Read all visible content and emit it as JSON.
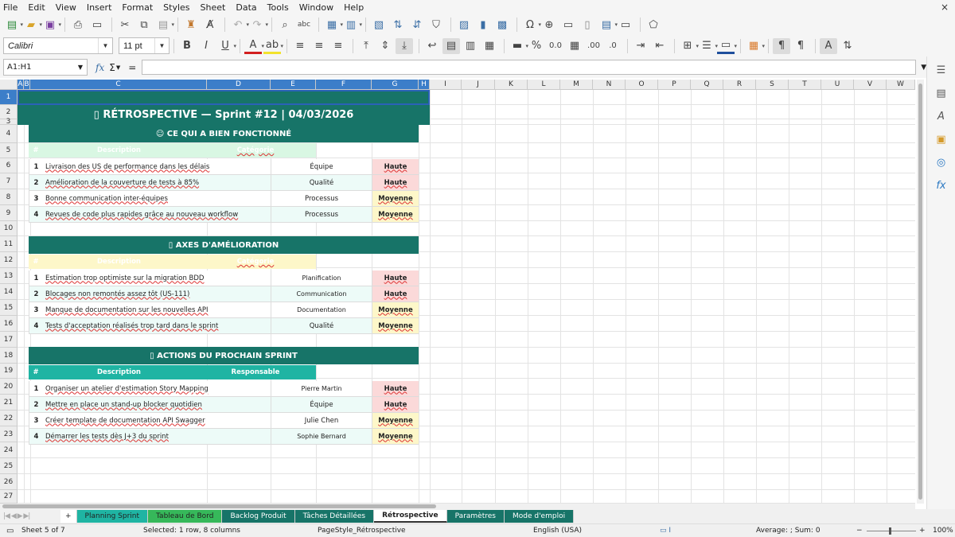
{
  "menu": [
    "File",
    "Edit",
    "View",
    "Insert",
    "Format",
    "Styles",
    "Sheet",
    "Data",
    "Tools",
    "Window",
    "Help"
  ],
  "close_glyph": "×",
  "font": {
    "name": "Calibri",
    "size": "11 pt"
  },
  "namebox": "A1:H1",
  "formula": {
    "fx": "fx",
    "sigma": "Σ",
    "eq": "="
  },
  "columns": [
    "A",
    "B",
    "C",
    "D",
    "E",
    "F",
    "G",
    "H",
    "I",
    "J",
    "K",
    "L",
    "M",
    "N",
    "O",
    "P",
    "Q",
    "R",
    "S",
    "T",
    "U",
    "V",
    "W"
  ],
  "rows": [
    "1",
    "2",
    "3",
    "4",
    "5",
    "6",
    "7",
    "8",
    "9",
    "10",
    "11",
    "12",
    "13",
    "14",
    "15",
    "16",
    "17",
    "18",
    "19",
    "20",
    "21",
    "22",
    "23",
    "24",
    "25",
    "26",
    "27"
  ],
  "title": "▯ RÉTROSPECTIVE  —  Sprint #12  |  04/03/2026",
  "sections": [
    {
      "title": "☺ CE QUI A BIEN FONCTIONNÉ",
      "header": {
        "hash": "#",
        "desc": "Description",
        "third": "Catégorie"
      },
      "rows": [
        {
          "n": "1",
          "desc": "Livraison des US de performance dans les délais",
          "cat": "Équipe",
          "pri": "Haute"
        },
        {
          "n": "2",
          "desc": "Amélioration de la couverture de tests à 85%",
          "cat": "Qualité",
          "pri": "Haute"
        },
        {
          "n": "3",
          "desc": "Bonne communication inter-équipes",
          "cat": "Processus",
          "pri": "Moyenne"
        },
        {
          "n": "4",
          "desc": "Revues de code plus rapides grâce au nouveau workflow",
          "cat": "Processus",
          "pri": "Moyenne"
        }
      ]
    },
    {
      "title": "▯ AXES D'AMÉLIORATION",
      "header": {
        "hash": "#",
        "desc": "Description",
        "third": "Catégorie"
      },
      "rows": [
        {
          "n": "1",
          "desc": "Estimation trop optimiste sur la migration BDD",
          "cat": "Planification",
          "pri": "Haute"
        },
        {
          "n": "2",
          "desc": "Blocages non remontés assez tôt (US-111)",
          "cat": "Communication",
          "pri": "Haute"
        },
        {
          "n": "3",
          "desc": "Manque de documentation sur les nouvelles API",
          "cat": "Documentation",
          "pri": "Moyenne"
        },
        {
          "n": "4",
          "desc": "Tests d'acceptation réalisés trop tard dans le sprint",
          "cat": "Qualité",
          "pri": "Moyenne"
        }
      ]
    },
    {
      "title": "▯ ACTIONS DU PROCHAIN SPRINT",
      "header": {
        "hash": "#",
        "desc": "Description",
        "third": "Responsable"
      },
      "rows": [
        {
          "n": "1",
          "desc": "Organiser un atelier d'estimation Story Mapping",
          "cat": "Pierre Martin",
          "pri": "Haute"
        },
        {
          "n": "2",
          "desc": "Mettre en place un stand-up blocker quotidien",
          "cat": "Équipe",
          "pri": "Haute"
        },
        {
          "n": "3",
          "desc": "Créer template de documentation API Swagger",
          "cat": "Julie Chen",
          "pri": "Moyenne"
        },
        {
          "n": "4",
          "desc": "Démarrer les tests dès J+3 du sprint",
          "cat": "Sophie Bernard",
          "pri": "Moyenne"
        }
      ]
    }
  ],
  "tabs": [
    "Planning Sprint",
    "Tableau de Bord",
    "Backlog Produit",
    "Tâches Détaillées",
    "Rétrospective",
    "Paramètres",
    "Mode d'emploi"
  ],
  "active_tab": "Rétrospective",
  "tab_add": "+",
  "status": {
    "sheet": "Sheet 5 of 7",
    "selection": "Selected: 1 row, 8 columns",
    "pagestyle": "PageStyle_Rétrospective",
    "language": "English (USA)",
    "sum": "Average: ; Sum: 0",
    "zoom": "100%"
  },
  "colors": {
    "teal_dark": "#177468",
    "teal_mid": "#1fb4a3",
    "green_light": "#d9f7e3",
    "yellow_light": "#fdf7c9",
    "red_light": "#fbd9d9",
    "row_tint": "#edfbf8"
  }
}
